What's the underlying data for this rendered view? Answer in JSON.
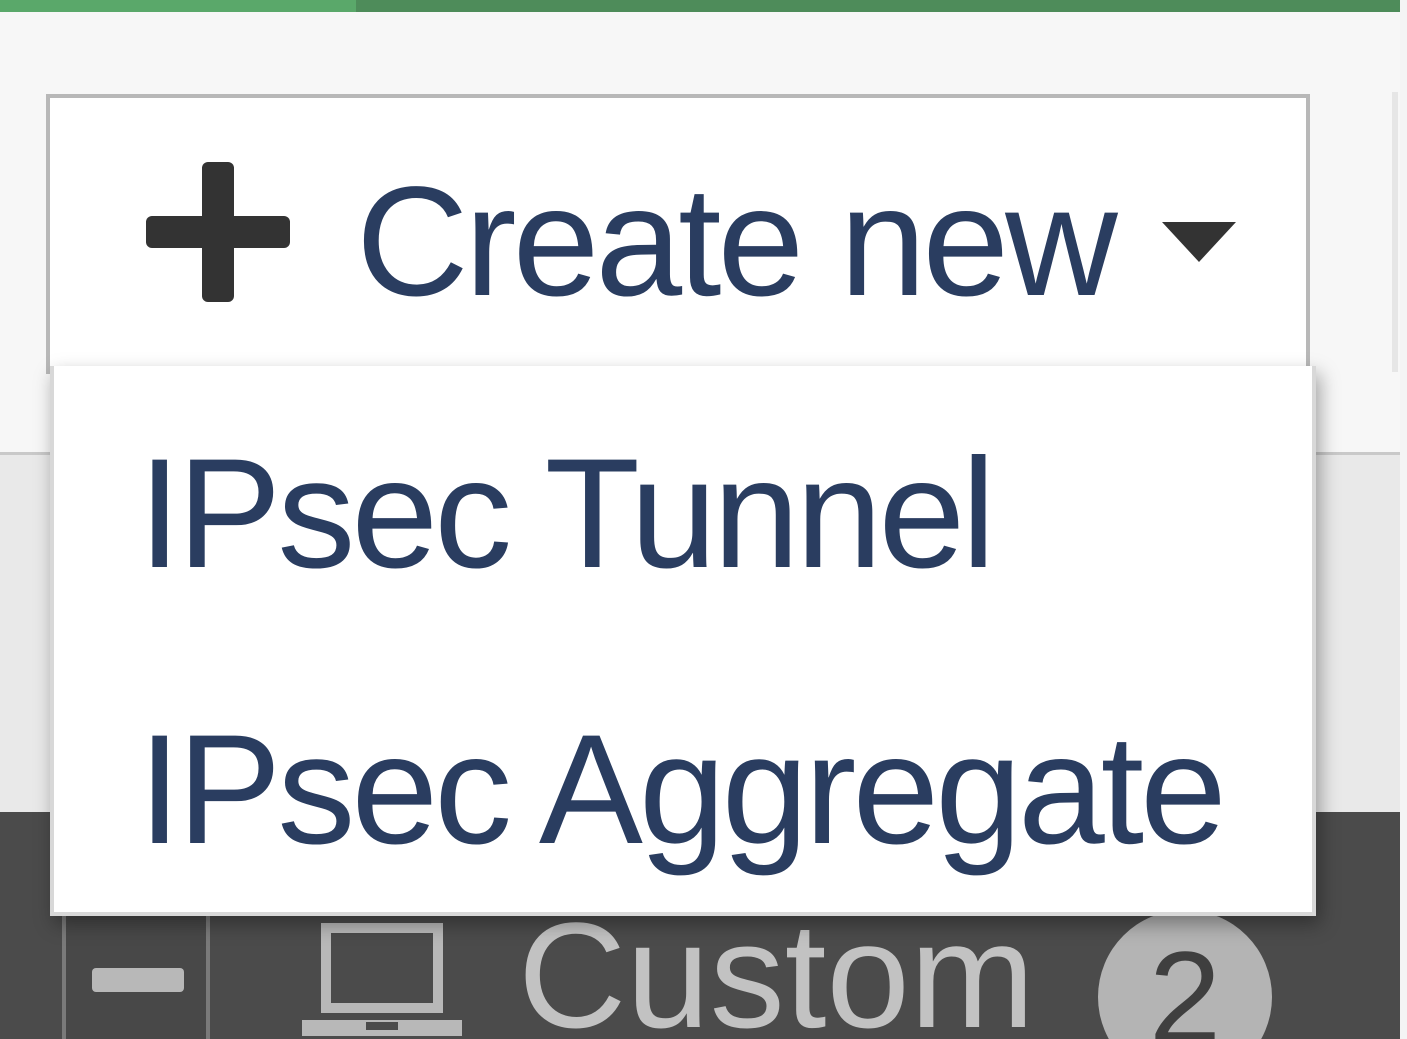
{
  "toolbar": {
    "create_button": {
      "label": "Create new",
      "icon": "plus-icon",
      "caret": "caret-down-icon"
    },
    "dropdown_items": [
      {
        "label": "IPsec Tunnel"
      },
      {
        "label": "IPsec Aggregate"
      }
    ]
  },
  "group": {
    "collapse_icon": "minus-icon",
    "icon": "monitor-icon",
    "label": "Custom",
    "count": "2"
  },
  "colors": {
    "accent": "#4e8c5a",
    "text": "#2a3d60",
    "group_bar": "#4b4b4b"
  }
}
